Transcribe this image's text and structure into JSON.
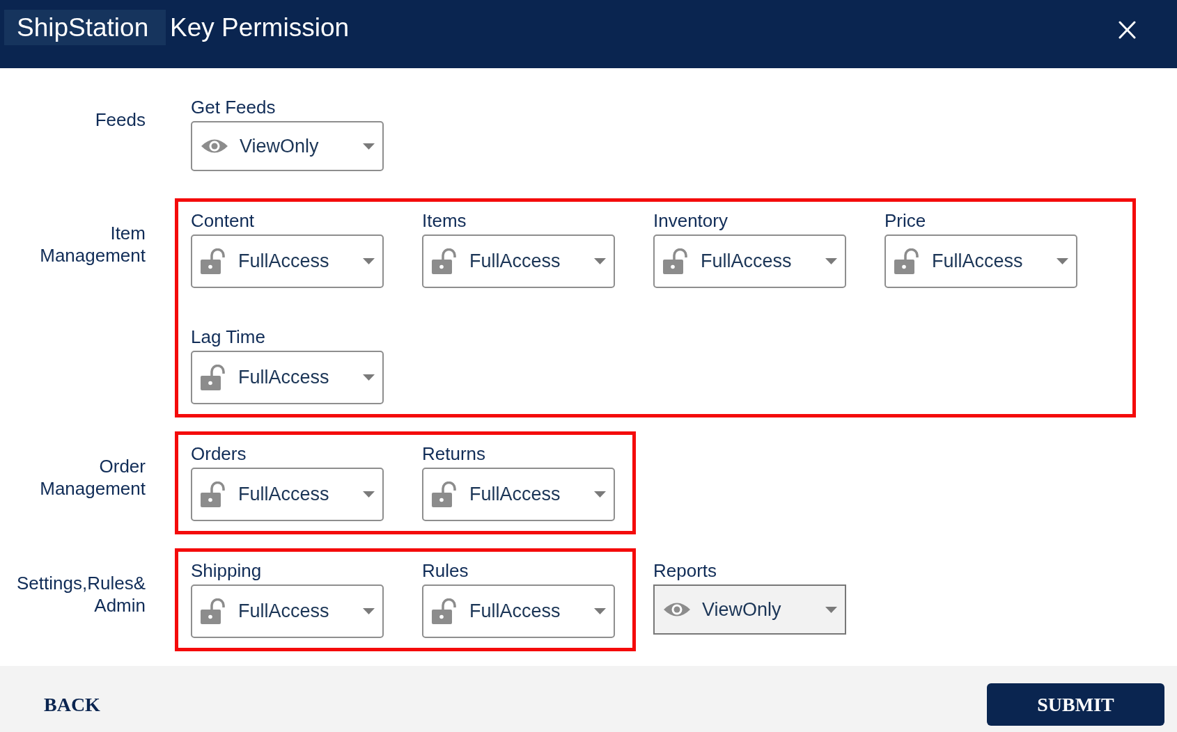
{
  "header": {
    "brand": "ShipStation",
    "title": "Key Permission"
  },
  "sections": [
    {
      "label": "Feeds",
      "groups": [
        {
          "highlighted": false,
          "fields": [
            {
              "label": "Get Feeds",
              "value": "ViewOnly",
              "kind": "view",
              "disabled": false
            }
          ]
        }
      ]
    },
    {
      "label": "Item Management",
      "groups": [
        {
          "highlighted": true,
          "fields": [
            {
              "label": "Content",
              "value": "FullAccess",
              "kind": "full",
              "disabled": false
            },
            {
              "label": "Items",
              "value": "FullAccess",
              "kind": "full",
              "disabled": false
            },
            {
              "label": "Inventory",
              "value": "FullAccess",
              "kind": "full",
              "disabled": false
            },
            {
              "label": "Price",
              "value": "FullAccess",
              "kind": "full",
              "disabled": false
            },
            {
              "label": "Lag Time",
              "value": "FullAccess",
              "kind": "full",
              "disabled": false
            }
          ]
        }
      ]
    },
    {
      "label": "Order Management",
      "groups": [
        {
          "highlighted": true,
          "fields": [
            {
              "label": "Orders",
              "value": "FullAccess",
              "kind": "full",
              "disabled": false
            },
            {
              "label": "Returns",
              "value": "FullAccess",
              "kind": "full",
              "disabled": false
            }
          ]
        }
      ]
    },
    {
      "label": "Settings,Rules& Admin",
      "groups": [
        {
          "highlighted": true,
          "fields": [
            {
              "label": "Shipping",
              "value": "FullAccess",
              "kind": "full",
              "disabled": false
            },
            {
              "label": "Rules",
              "value": "FullAccess",
              "kind": "full",
              "disabled": false
            }
          ]
        },
        {
          "highlighted": false,
          "fields": [
            {
              "label": "Reports",
              "value": "ViewOnly",
              "kind": "view",
              "disabled": true
            }
          ]
        }
      ]
    }
  ],
  "footer": {
    "back": "BACK",
    "submit": "SUBMIT"
  }
}
